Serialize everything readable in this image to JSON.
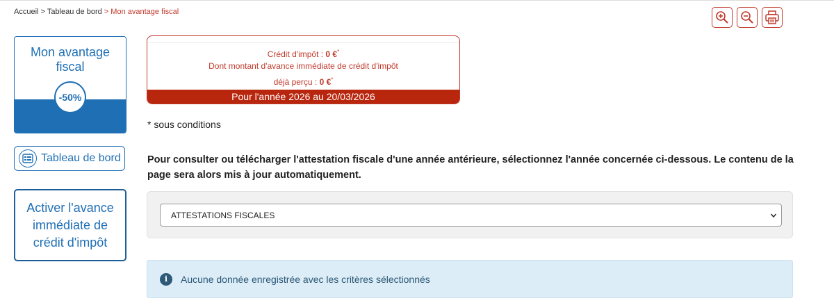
{
  "breadcrumb": {
    "items": [
      "Accueil",
      "Tableau de bord"
    ],
    "separator": ">",
    "current": "Mon avantage fiscal"
  },
  "toolbar": {
    "zoom_in_icon": "zoom-in-icon",
    "zoom_out_icon": "zoom-out-icon",
    "print_icon": "print-icon"
  },
  "sidebar": {
    "avantage": {
      "title": "Mon avantage fiscal",
      "badge": "-50%"
    },
    "dashboard_label": "Tableau de bord",
    "activer_label": "Activer l'avance immédiate de crédit d'impôt"
  },
  "credit": {
    "line1_prefix": "Crédit d'impôt : ",
    "line1_value": "0 €",
    "line2": "Dont montant d'avance immédiate de crédit d'impôt",
    "line3_prefix": "déjà perçu : ",
    "line3_value": "0 €",
    "asterisk": "*",
    "footer": "Pour l'année 2026 au 20/03/2026"
  },
  "conditions": "*  sous conditions",
  "instructions": "Pour consulter ou télécharger l'attestation fiscale d'une année antérieure, sélectionnez l'année concernée ci-dessous. Le contenu de la page sera alors mis à jour automatiquement.",
  "select": {
    "value": "ATTESTATIONS FISCALES"
  },
  "info": {
    "icon": "info-icon",
    "icon_glyph": "i",
    "message": "Aucune donnée enregistrée avec les critères sélectionnés"
  },
  "colors": {
    "accent_red": "#c0392b",
    "brand_blue": "#1f6fb5",
    "info_bg": "#dcedf7"
  }
}
